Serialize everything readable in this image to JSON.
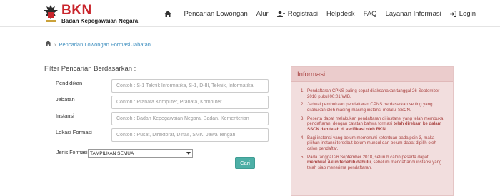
{
  "header": {
    "logo_title": "BKN",
    "logo_subtitle": "Badan Kepegawaian Negara",
    "nav": [
      {
        "label": "",
        "icon": "home-icon"
      },
      {
        "label": "Pencarian Lowongan",
        "icon": ""
      },
      {
        "label": "Alur",
        "icon": ""
      },
      {
        "label": "Registrasi",
        "icon": "user-plus-icon"
      },
      {
        "label": "Helpdesk",
        "icon": ""
      },
      {
        "label": "FAQ",
        "icon": ""
      },
      {
        "label": "Layanan Informasi",
        "icon": ""
      },
      {
        "label": "Login",
        "icon": "login-icon"
      }
    ]
  },
  "breadcrumb": {
    "home_icon": "home-icon",
    "current": "Pencarian Lowongan Formasi Jabatan"
  },
  "filter": {
    "title": "Filter Pencarian Berdasarkan :",
    "fields": [
      {
        "label": "Pendidikan",
        "placeholder": "Contoh : S-1 Teknik Informatika, S-1, D-III, Teknik, Informatika"
      },
      {
        "label": "Jabatan",
        "placeholder": "Contoh : Pranata Komputer, Pranata, Komputer"
      },
      {
        "label": "Instansi",
        "placeholder": "Contoh : Badan Kepegawaian Negara, Badan, Kementerian"
      },
      {
        "label": "Lokasi Formasi",
        "placeholder": "Contoh : Pusat, Direktorat, Dinas, SMK, Jawa Tengah"
      }
    ],
    "jenis_label": "Jenis Formasi:",
    "jenis_value": "TAMPILKAN SEMUA",
    "search_button": "Cari"
  },
  "info": {
    "title": "Informasi",
    "items": [
      {
        "num": "1.",
        "pre": "Pendaftaran CPNS paling cepat dilaksanakan tanggal 26 September 2018 pukul 00:01 WIB.",
        "bold": "",
        "post": ""
      },
      {
        "num": "2.",
        "pre": "Jadwal pembukaan pendaftaran CPNS berdasarkan setting yang dilakukan oleh masing-masing instansi melalui SSCN.",
        "bold": "",
        "post": ""
      },
      {
        "num": "3.",
        "pre": "Peserta dapat melakukan pendaftaran di instansi yang telah membuka pendaftaran, dengan catatan bahwa formasi ",
        "bold": "telah direkam ke dalam SSCN dan telah di verifikasi oleh BKN.",
        "post": ""
      },
      {
        "num": "4.",
        "pre": "Bagi instansi yang belum memenuhi ketentuan pada poin 3, maka pilihan instansi tersebut belum muncul dan belum dapat dipilih oleh calon pendaftar.",
        "bold": "",
        "post": ""
      },
      {
        "num": "5.",
        "pre": "Pada tanggal 26 September 2018, seluruh calon peserta dapat ",
        "bold": "membuat Akun terlebih dahulu",
        "post": ", sebelum mendaftar di instansi yang telah siap menerima pendaftaran."
      }
    ]
  }
}
